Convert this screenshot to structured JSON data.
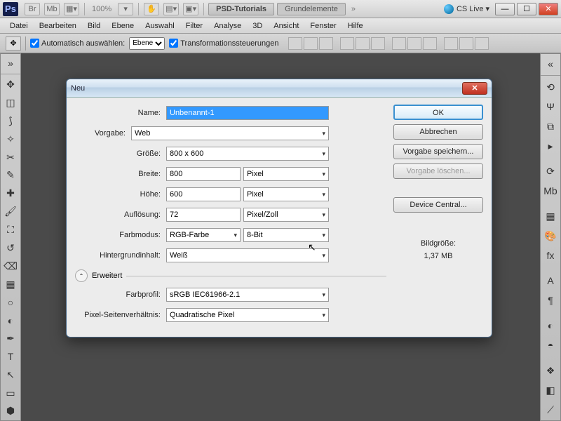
{
  "titlebar": {
    "zoom": "100%",
    "tab1": "PSD-Tutorials",
    "tab2": "Grundelemente",
    "cslive": "CS Live"
  },
  "menu": [
    "Datei",
    "Bearbeiten",
    "Bild",
    "Ebene",
    "Auswahl",
    "Filter",
    "Analyse",
    "3D",
    "Ansicht",
    "Fenster",
    "Hilfe"
  ],
  "options": {
    "autoselect": "Automatisch auswählen:",
    "layer": "Ebene",
    "transform": "Transformationssteuerungen"
  },
  "dialog": {
    "title": "Neu",
    "labels": {
      "name": "Name:",
      "preset": "Vorgabe:",
      "size": "Größe:",
      "width": "Breite:",
      "height": "Höhe:",
      "resolution": "Auflösung:",
      "colormode": "Farbmodus:",
      "bgcontent": "Hintergrundinhalt:",
      "advanced": "Erweitert",
      "profile": "Farbprofil:",
      "pixelAspect": "Pixel-Seitenverhältnis:"
    },
    "values": {
      "name": "Unbenannt-1",
      "preset": "Web",
      "size": "800 x 600",
      "width": "800",
      "width_unit": "Pixel",
      "height": "600",
      "height_unit": "Pixel",
      "resolution": "72",
      "resolution_unit": "Pixel/Zoll",
      "colormode": "RGB-Farbe",
      "bitdepth": "8-Bit",
      "bgcontent": "Weiß",
      "profile": "sRGB IEC61966-2.1",
      "pixelAspect": "Quadratische Pixel"
    },
    "buttons": {
      "ok": "OK",
      "cancel": "Abbrechen",
      "savePreset": "Vorgabe speichern...",
      "deletePreset": "Vorgabe löschen...",
      "deviceCentral": "Device Central..."
    },
    "sizeInfo": {
      "label": "Bildgröße:",
      "value": "1,37 MB"
    }
  }
}
